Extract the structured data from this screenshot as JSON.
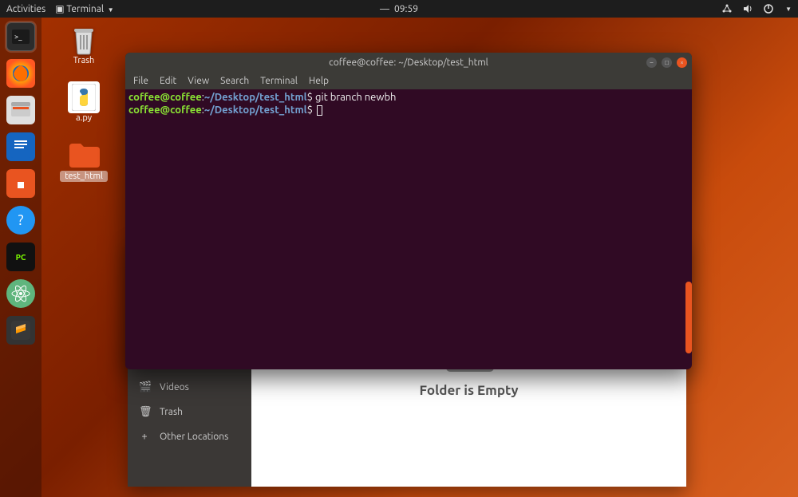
{
  "topbar": {
    "activities": "Activities",
    "app_indicator": "Terminal",
    "time": "09:59"
  },
  "dock": {
    "terminal": "Terminal",
    "firefox": "Firefox",
    "files": "Files",
    "writer": "LibreOffice Writer",
    "software": "Ubuntu Software",
    "help": "Help",
    "pycharm_label": "PC",
    "pycharm": "PyCharm",
    "atom": "Atom",
    "sublime": "Sublime Text"
  },
  "desktop": {
    "trash": "Trash",
    "apy": "a.py",
    "folder": "test_html"
  },
  "files_window": {
    "sidebar": {
      "videos": "Videos",
      "trash": "Trash",
      "other": "Other Locations"
    },
    "empty": "Folder is Empty"
  },
  "terminal": {
    "title": "coffee@coffee: ~/Desktop/test_html",
    "menu": {
      "file": "File",
      "edit": "Edit",
      "view": "View",
      "search": "Search",
      "terminal": "Terminal",
      "help": "Help"
    },
    "prompt_user": "coffee@coffee",
    "prompt_sep": ":",
    "prompt_path": "~/Desktop/test_html",
    "prompt_dollar": "$",
    "lines": [
      {
        "cmd": "git branch newbh"
      },
      {
        "cmd": ""
      }
    ]
  }
}
